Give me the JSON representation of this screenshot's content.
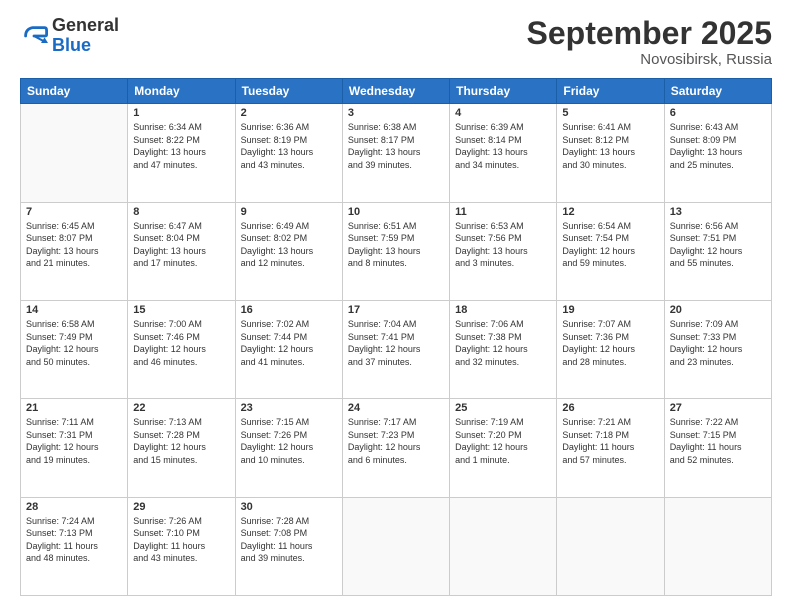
{
  "header": {
    "logo_general": "General",
    "logo_blue": "Blue",
    "month_title": "September 2025",
    "location": "Novosibirsk, Russia"
  },
  "days_of_week": [
    "Sunday",
    "Monday",
    "Tuesday",
    "Wednesday",
    "Thursday",
    "Friday",
    "Saturday"
  ],
  "weeks": [
    [
      {
        "day": "",
        "info": ""
      },
      {
        "day": "1",
        "info": "Sunrise: 6:34 AM\nSunset: 8:22 PM\nDaylight: 13 hours\nand 47 minutes."
      },
      {
        "day": "2",
        "info": "Sunrise: 6:36 AM\nSunset: 8:19 PM\nDaylight: 13 hours\nand 43 minutes."
      },
      {
        "day": "3",
        "info": "Sunrise: 6:38 AM\nSunset: 8:17 PM\nDaylight: 13 hours\nand 39 minutes."
      },
      {
        "day": "4",
        "info": "Sunrise: 6:39 AM\nSunset: 8:14 PM\nDaylight: 13 hours\nand 34 minutes."
      },
      {
        "day": "5",
        "info": "Sunrise: 6:41 AM\nSunset: 8:12 PM\nDaylight: 13 hours\nand 30 minutes."
      },
      {
        "day": "6",
        "info": "Sunrise: 6:43 AM\nSunset: 8:09 PM\nDaylight: 13 hours\nand 25 minutes."
      }
    ],
    [
      {
        "day": "7",
        "info": "Sunrise: 6:45 AM\nSunset: 8:07 PM\nDaylight: 13 hours\nand 21 minutes."
      },
      {
        "day": "8",
        "info": "Sunrise: 6:47 AM\nSunset: 8:04 PM\nDaylight: 13 hours\nand 17 minutes."
      },
      {
        "day": "9",
        "info": "Sunrise: 6:49 AM\nSunset: 8:02 PM\nDaylight: 13 hours\nand 12 minutes."
      },
      {
        "day": "10",
        "info": "Sunrise: 6:51 AM\nSunset: 7:59 PM\nDaylight: 13 hours\nand 8 minutes."
      },
      {
        "day": "11",
        "info": "Sunrise: 6:53 AM\nSunset: 7:56 PM\nDaylight: 13 hours\nand 3 minutes."
      },
      {
        "day": "12",
        "info": "Sunrise: 6:54 AM\nSunset: 7:54 PM\nDaylight: 12 hours\nand 59 minutes."
      },
      {
        "day": "13",
        "info": "Sunrise: 6:56 AM\nSunset: 7:51 PM\nDaylight: 12 hours\nand 55 minutes."
      }
    ],
    [
      {
        "day": "14",
        "info": "Sunrise: 6:58 AM\nSunset: 7:49 PM\nDaylight: 12 hours\nand 50 minutes."
      },
      {
        "day": "15",
        "info": "Sunrise: 7:00 AM\nSunset: 7:46 PM\nDaylight: 12 hours\nand 46 minutes."
      },
      {
        "day": "16",
        "info": "Sunrise: 7:02 AM\nSunset: 7:44 PM\nDaylight: 12 hours\nand 41 minutes."
      },
      {
        "day": "17",
        "info": "Sunrise: 7:04 AM\nSunset: 7:41 PM\nDaylight: 12 hours\nand 37 minutes."
      },
      {
        "day": "18",
        "info": "Sunrise: 7:06 AM\nSunset: 7:38 PM\nDaylight: 12 hours\nand 32 minutes."
      },
      {
        "day": "19",
        "info": "Sunrise: 7:07 AM\nSunset: 7:36 PM\nDaylight: 12 hours\nand 28 minutes."
      },
      {
        "day": "20",
        "info": "Sunrise: 7:09 AM\nSunset: 7:33 PM\nDaylight: 12 hours\nand 23 minutes."
      }
    ],
    [
      {
        "day": "21",
        "info": "Sunrise: 7:11 AM\nSunset: 7:31 PM\nDaylight: 12 hours\nand 19 minutes."
      },
      {
        "day": "22",
        "info": "Sunrise: 7:13 AM\nSunset: 7:28 PM\nDaylight: 12 hours\nand 15 minutes."
      },
      {
        "day": "23",
        "info": "Sunrise: 7:15 AM\nSunset: 7:26 PM\nDaylight: 12 hours\nand 10 minutes."
      },
      {
        "day": "24",
        "info": "Sunrise: 7:17 AM\nSunset: 7:23 PM\nDaylight: 12 hours\nand 6 minutes."
      },
      {
        "day": "25",
        "info": "Sunrise: 7:19 AM\nSunset: 7:20 PM\nDaylight: 12 hours\nand 1 minute."
      },
      {
        "day": "26",
        "info": "Sunrise: 7:21 AM\nSunset: 7:18 PM\nDaylight: 11 hours\nand 57 minutes."
      },
      {
        "day": "27",
        "info": "Sunrise: 7:22 AM\nSunset: 7:15 PM\nDaylight: 11 hours\nand 52 minutes."
      }
    ],
    [
      {
        "day": "28",
        "info": "Sunrise: 7:24 AM\nSunset: 7:13 PM\nDaylight: 11 hours\nand 48 minutes."
      },
      {
        "day": "29",
        "info": "Sunrise: 7:26 AM\nSunset: 7:10 PM\nDaylight: 11 hours\nand 43 minutes."
      },
      {
        "day": "30",
        "info": "Sunrise: 7:28 AM\nSunset: 7:08 PM\nDaylight: 11 hours\nand 39 minutes."
      },
      {
        "day": "",
        "info": ""
      },
      {
        "day": "",
        "info": ""
      },
      {
        "day": "",
        "info": ""
      },
      {
        "day": "",
        "info": ""
      }
    ]
  ]
}
